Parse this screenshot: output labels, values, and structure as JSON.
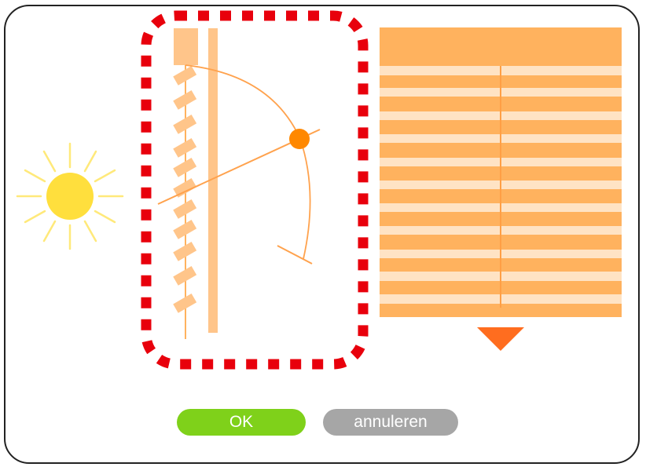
{
  "dialog": {
    "ok_label": "OK",
    "cancel_label": "annuleren"
  },
  "icons": [
    "sun-icon",
    "slat-tilt-diagram",
    "blind-icon",
    "down-arrow-icon"
  ],
  "colors": {
    "slat_orange": "#ffb25e",
    "slat_light": "#ffe3c4",
    "handle_orange": "#ff8800",
    "arrow_orange": "#ff6d1f",
    "sun_yellow": "#ffdf3d",
    "sun_rays": "#ffe97a",
    "highlight_red": "#e8000c",
    "ok_green": "#7fd11a",
    "cancel_gray": "#a6a6a6"
  }
}
